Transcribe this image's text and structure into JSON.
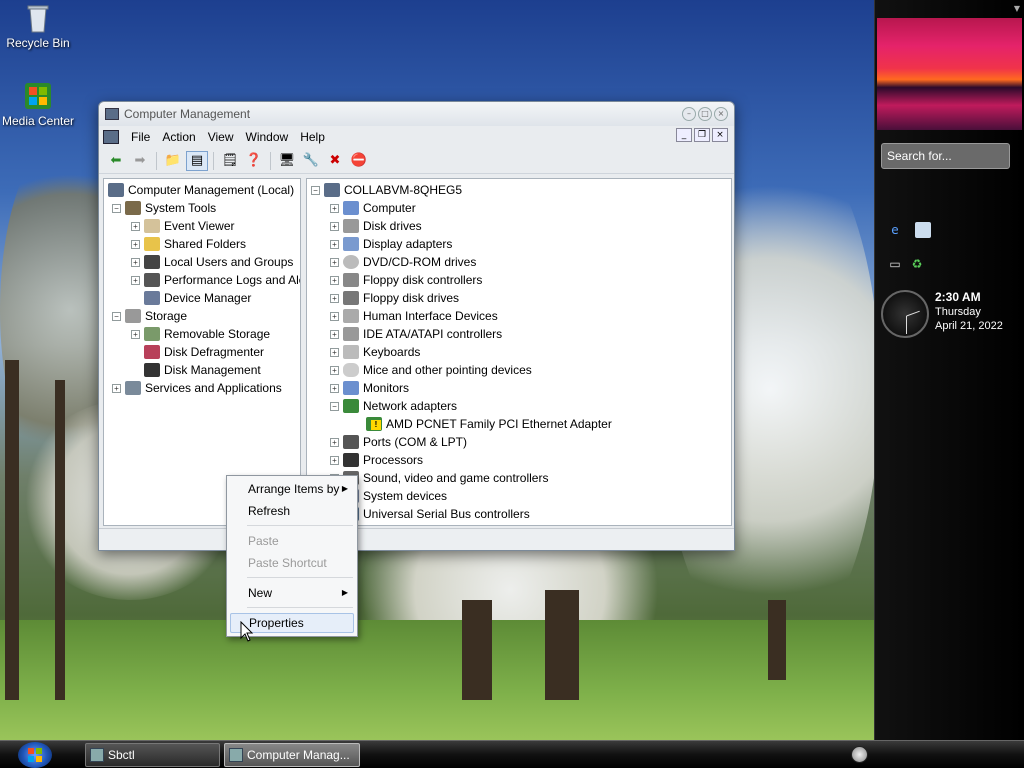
{
  "desktop": {
    "icons": [
      {
        "label": "Recycle Bin",
        "icon": "recycle-bin-icon"
      },
      {
        "label": "Media Center",
        "icon": "media-center-icon"
      }
    ]
  },
  "window": {
    "title": "Computer Management",
    "menu": [
      "File",
      "Action",
      "View",
      "Window",
      "Help"
    ],
    "toolbar_icons": [
      "back-icon",
      "forward-icon",
      "up-folder-icon",
      "show-hide-tree-icon",
      "properties-icon",
      "help-icon",
      "scan-hardware-icon",
      "update-driver-icon",
      "uninstall-icon",
      "disable-icon"
    ],
    "left_tree": [
      {
        "label": "Computer Management (Local)",
        "level": 0,
        "expander": "",
        "icon": "computer-management-icon"
      },
      {
        "label": "System Tools",
        "level": 1,
        "expander": "−",
        "icon": "system-tools-icon"
      },
      {
        "label": "Event Viewer",
        "level": 2,
        "expander": "+",
        "icon": "event-viewer-icon"
      },
      {
        "label": "Shared Folders",
        "level": 2,
        "expander": "+",
        "icon": "shared-folders-icon"
      },
      {
        "label": "Local Users and Groups",
        "level": 2,
        "expander": "+",
        "icon": "local-users-icon"
      },
      {
        "label": "Performance Logs and Ale",
        "level": 2,
        "expander": "+",
        "icon": "performance-logs-icon"
      },
      {
        "label": "Device Manager",
        "level": 2,
        "expander": "",
        "icon": "device-manager-icon"
      },
      {
        "label": "Storage",
        "level": 1,
        "expander": "−",
        "icon": "storage-icon"
      },
      {
        "label": "Removable Storage",
        "level": 2,
        "expander": "+",
        "icon": "removable-storage-icon"
      },
      {
        "label": "Disk Defragmenter",
        "level": 2,
        "expander": "",
        "icon": "disk-defragmenter-icon"
      },
      {
        "label": "Disk Management",
        "level": 2,
        "expander": "",
        "icon": "disk-management-icon"
      },
      {
        "label": "Services and Applications",
        "level": 1,
        "expander": "+",
        "icon": "services-applications-icon"
      }
    ],
    "right_tree": [
      {
        "label": "COLLABVM-8QHEG5",
        "level": 0,
        "expander": "−",
        "icon": "computer-icon"
      },
      {
        "label": "Computer",
        "level": 1,
        "expander": "+",
        "icon": "computer-icon"
      },
      {
        "label": "Disk drives",
        "level": 1,
        "expander": "+",
        "icon": "disk-drive-icon"
      },
      {
        "label": "Display adapters",
        "level": 1,
        "expander": "+",
        "icon": "display-adapter-icon"
      },
      {
        "label": "DVD/CD-ROM drives",
        "level": 1,
        "expander": "+",
        "icon": "cdrom-icon"
      },
      {
        "label": "Floppy disk controllers",
        "level": 1,
        "expander": "+",
        "icon": "floppy-controller-icon"
      },
      {
        "label": "Floppy disk drives",
        "level": 1,
        "expander": "+",
        "icon": "floppy-drive-icon"
      },
      {
        "label": "Human Interface Devices",
        "level": 1,
        "expander": "+",
        "icon": "hid-icon"
      },
      {
        "label": "IDE ATA/ATAPI controllers",
        "level": 1,
        "expander": "+",
        "icon": "ide-controller-icon"
      },
      {
        "label": "Keyboards",
        "level": 1,
        "expander": "+",
        "icon": "keyboard-icon"
      },
      {
        "label": "Mice and other pointing devices",
        "level": 1,
        "expander": "+",
        "icon": "mouse-icon"
      },
      {
        "label": "Monitors",
        "level": 1,
        "expander": "+",
        "icon": "monitor-icon"
      },
      {
        "label": "Network adapters",
        "level": 1,
        "expander": "−",
        "icon": "network-adapter-icon"
      },
      {
        "label": "AMD PCNET Family PCI Ethernet Adapter",
        "level": 2,
        "expander": "",
        "icon": "warning-network-icon"
      },
      {
        "label": "Ports (COM & LPT)",
        "level": 1,
        "expander": "+",
        "icon": "ports-icon"
      },
      {
        "label": "Processors",
        "level": 1,
        "expander": "+",
        "icon": "processor-icon"
      },
      {
        "label": "Sound, video and game controllers",
        "level": 1,
        "expander": "+",
        "icon": "sound-icon"
      },
      {
        "label": "System devices",
        "level": 1,
        "expander": "+",
        "icon": "system-devices-icon"
      },
      {
        "label": "Universal Serial Bus controllers",
        "level": 1,
        "expander": "+",
        "icon": "usb-icon"
      }
    ]
  },
  "context_menu": {
    "items": [
      {
        "label": "Arrange Items by",
        "disabled": false,
        "submenu": true,
        "highlighted": false
      },
      {
        "label": "Refresh",
        "disabled": false,
        "submenu": false,
        "highlighted": false
      },
      {
        "label": "Paste",
        "disabled": true,
        "submenu": false,
        "highlighted": false
      },
      {
        "label": "Paste Shortcut",
        "disabled": true,
        "submenu": false,
        "highlighted": false
      },
      {
        "label": "New",
        "disabled": false,
        "submenu": true,
        "highlighted": false
      },
      {
        "label": "Properties",
        "disabled": false,
        "submenu": false,
        "highlighted": true
      }
    ]
  },
  "sidebar": {
    "search_placeholder": "Search for...",
    "clock": {
      "time": "2:30 AM",
      "day": "Thursday",
      "date": "April 21, 2022"
    }
  },
  "taskbar": {
    "tasks": [
      {
        "label": "Sbctl",
        "active": false
      },
      {
        "label": "Computer Manag...",
        "active": true
      }
    ]
  },
  "colors": {
    "accent": "#3399ff",
    "sidebar_bg": "#000000",
    "highlight": "#e6eef9"
  }
}
